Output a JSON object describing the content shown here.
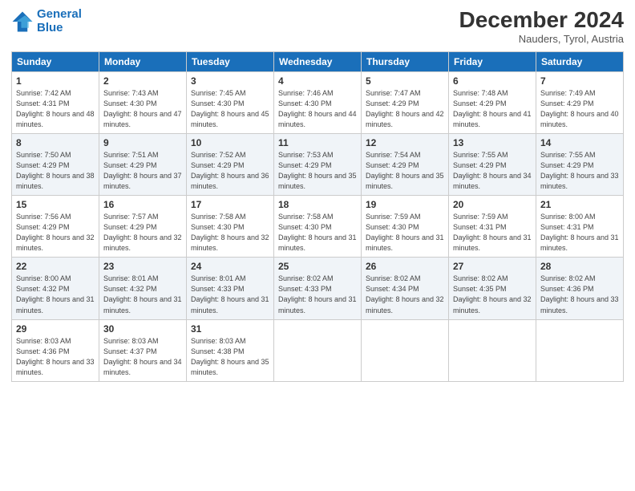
{
  "header": {
    "logo_line1": "General",
    "logo_line2": "Blue",
    "month": "December 2024",
    "location": "Nauders, Tyrol, Austria"
  },
  "days_of_week": [
    "Sunday",
    "Monday",
    "Tuesday",
    "Wednesday",
    "Thursday",
    "Friday",
    "Saturday"
  ],
  "weeks": [
    [
      {
        "day": 1,
        "sunrise": "7:42 AM",
        "sunset": "4:31 PM",
        "daylight": "8 hours and 48 minutes."
      },
      {
        "day": 2,
        "sunrise": "7:43 AM",
        "sunset": "4:30 PM",
        "daylight": "8 hours and 47 minutes."
      },
      {
        "day": 3,
        "sunrise": "7:45 AM",
        "sunset": "4:30 PM",
        "daylight": "8 hours and 45 minutes."
      },
      {
        "day": 4,
        "sunrise": "7:46 AM",
        "sunset": "4:30 PM",
        "daylight": "8 hours and 44 minutes."
      },
      {
        "day": 5,
        "sunrise": "7:47 AM",
        "sunset": "4:29 PM",
        "daylight": "8 hours and 42 minutes."
      },
      {
        "day": 6,
        "sunrise": "7:48 AM",
        "sunset": "4:29 PM",
        "daylight": "8 hours and 41 minutes."
      },
      {
        "day": 7,
        "sunrise": "7:49 AM",
        "sunset": "4:29 PM",
        "daylight": "8 hours and 40 minutes."
      }
    ],
    [
      {
        "day": 8,
        "sunrise": "7:50 AM",
        "sunset": "4:29 PM",
        "daylight": "8 hours and 38 minutes."
      },
      {
        "day": 9,
        "sunrise": "7:51 AM",
        "sunset": "4:29 PM",
        "daylight": "8 hours and 37 minutes."
      },
      {
        "day": 10,
        "sunrise": "7:52 AM",
        "sunset": "4:29 PM",
        "daylight": "8 hours and 36 minutes."
      },
      {
        "day": 11,
        "sunrise": "7:53 AM",
        "sunset": "4:29 PM",
        "daylight": "8 hours and 35 minutes."
      },
      {
        "day": 12,
        "sunrise": "7:54 AM",
        "sunset": "4:29 PM",
        "daylight": "8 hours and 35 minutes."
      },
      {
        "day": 13,
        "sunrise": "7:55 AM",
        "sunset": "4:29 PM",
        "daylight": "8 hours and 34 minutes."
      },
      {
        "day": 14,
        "sunrise": "7:55 AM",
        "sunset": "4:29 PM",
        "daylight": "8 hours and 33 minutes."
      }
    ],
    [
      {
        "day": 15,
        "sunrise": "7:56 AM",
        "sunset": "4:29 PM",
        "daylight": "8 hours and 32 minutes."
      },
      {
        "day": 16,
        "sunrise": "7:57 AM",
        "sunset": "4:29 PM",
        "daylight": "8 hours and 32 minutes."
      },
      {
        "day": 17,
        "sunrise": "7:58 AM",
        "sunset": "4:30 PM",
        "daylight": "8 hours and 32 minutes."
      },
      {
        "day": 18,
        "sunrise": "7:58 AM",
        "sunset": "4:30 PM",
        "daylight": "8 hours and 31 minutes."
      },
      {
        "day": 19,
        "sunrise": "7:59 AM",
        "sunset": "4:30 PM",
        "daylight": "8 hours and 31 minutes."
      },
      {
        "day": 20,
        "sunrise": "7:59 AM",
        "sunset": "4:31 PM",
        "daylight": "8 hours and 31 minutes."
      },
      {
        "day": 21,
        "sunrise": "8:00 AM",
        "sunset": "4:31 PM",
        "daylight": "8 hours and 31 minutes."
      }
    ],
    [
      {
        "day": 22,
        "sunrise": "8:00 AM",
        "sunset": "4:32 PM",
        "daylight": "8 hours and 31 minutes."
      },
      {
        "day": 23,
        "sunrise": "8:01 AM",
        "sunset": "4:32 PM",
        "daylight": "8 hours and 31 minutes."
      },
      {
        "day": 24,
        "sunrise": "8:01 AM",
        "sunset": "4:33 PM",
        "daylight": "8 hours and 31 minutes."
      },
      {
        "day": 25,
        "sunrise": "8:02 AM",
        "sunset": "4:33 PM",
        "daylight": "8 hours and 31 minutes."
      },
      {
        "day": 26,
        "sunrise": "8:02 AM",
        "sunset": "4:34 PM",
        "daylight": "8 hours and 32 minutes."
      },
      {
        "day": 27,
        "sunrise": "8:02 AM",
        "sunset": "4:35 PM",
        "daylight": "8 hours and 32 minutes."
      },
      {
        "day": 28,
        "sunrise": "8:02 AM",
        "sunset": "4:36 PM",
        "daylight": "8 hours and 33 minutes."
      }
    ],
    [
      {
        "day": 29,
        "sunrise": "8:03 AM",
        "sunset": "4:36 PM",
        "daylight": "8 hours and 33 minutes."
      },
      {
        "day": 30,
        "sunrise": "8:03 AM",
        "sunset": "4:37 PM",
        "daylight": "8 hours and 34 minutes."
      },
      {
        "day": 31,
        "sunrise": "8:03 AM",
        "sunset": "4:38 PM",
        "daylight": "8 hours and 35 minutes."
      },
      null,
      null,
      null,
      null
    ]
  ]
}
